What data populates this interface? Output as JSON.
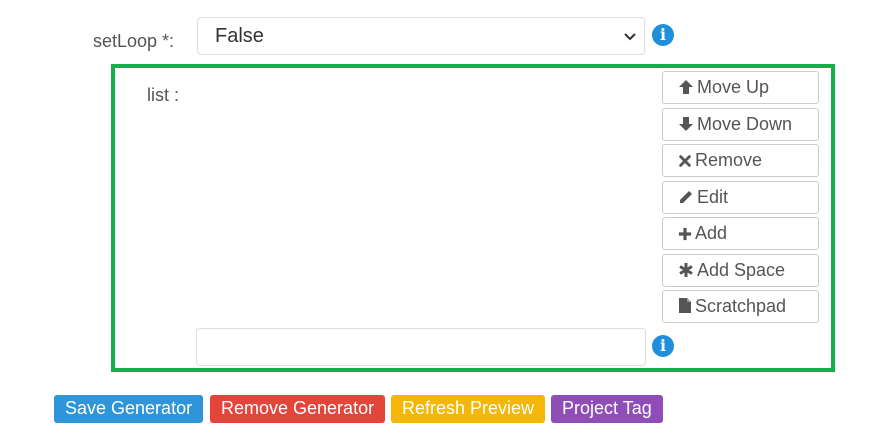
{
  "form": {
    "setloop_label": "setLoop *:",
    "setloop_value": "False",
    "list_label": "list :",
    "list_input_value": ""
  },
  "list_buttons": [
    {
      "label": "Move Up",
      "icon": "arrow-up-icon"
    },
    {
      "label": "Move Down",
      "icon": "arrow-down-icon"
    },
    {
      "label": "Remove",
      "icon": "x-icon"
    },
    {
      "label": "Edit",
      "icon": "pencil-icon"
    },
    {
      "label": "Add",
      "icon": "plus-icon"
    },
    {
      "label": "Add Space",
      "icon": "asterisk-icon"
    },
    {
      "label": "Scratchpad",
      "icon": "file-icon"
    }
  ],
  "actions": {
    "save": "Save Generator",
    "remove": "Remove Generator",
    "refresh": "Refresh Preview",
    "project_tag": "Project Tag"
  },
  "colors": {
    "accent_green": "#13b04a",
    "info_blue": "#1f8fdb",
    "save_blue": "#2f95da",
    "remove_red": "#e4453b",
    "refresh_yellow": "#f6b607",
    "tag_purple": "#8f4db7"
  }
}
